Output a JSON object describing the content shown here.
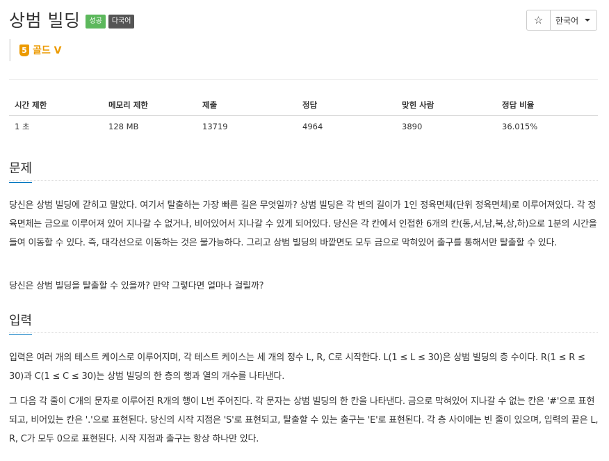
{
  "header": {
    "title": "상범 빌딩",
    "badge_success": "성공",
    "badge_lang": "다국어",
    "star_glyph": "☆",
    "language": "한국어"
  },
  "tier": {
    "number": "5",
    "label": "골드 V",
    "color": "#ec9a00"
  },
  "info_table": {
    "headers": [
      "시간 제한",
      "메모리 제한",
      "제출",
      "정답",
      "맞힌 사람",
      "정답 비율"
    ],
    "values": [
      "1 초",
      "128 MB",
      "13719",
      "4964",
      "3890",
      "36.015%"
    ]
  },
  "sections": {
    "problem": {
      "title": "문제",
      "paragraphs": [
        "당신은 상범 빌딩에 갇히고 말았다. 여기서 탈출하는 가장 빠른 길은 무엇일까? 상범 빌딩은 각 변의 길이가 1인 정육면체(단위 정육면체)로 이루어져있다. 각 정육면체는 금으로 이루어져 있어 지나갈 수 없거나, 비어있어서 지나갈 수 있게 되어있다. 당신은 각 칸에서 인접한 6개의 칸(동,서,남,북,상,하)으로 1분의 시간을 들여 이동할 수 있다. 즉, 대각선으로 이동하는 것은 불가능하다. 그리고 상범 빌딩의 바깥면도 모두 금으로 막혀있어 출구를 통해서만 탈출할 수 있다.",
        "당신은 상범 빌딩을 탈출할 수 있을까? 만약 그렇다면 얼마나 걸릴까?"
      ]
    },
    "input": {
      "title": "입력",
      "paragraphs": [
        "입력은 여러 개의 테스트 케이스로 이루어지며, 각 테스트 케이스는 세 개의 정수 L, R, C로 시작한다. L(1 ≤ L ≤ 30)은 상범 빌딩의 층 수이다. R(1 ≤ R ≤ 30)과 C(1 ≤ C ≤ 30)는 상범 빌딩의 한 층의 행과 열의 개수를 나타낸다.",
        "그 다음 각 줄이 C개의 문자로 이루어진 R개의 행이 L번 주어진다. 각 문자는 상범 빌딩의 한 칸을 나타낸다. 금으로 막혀있어 지나갈 수 없는 칸은 '#'으로 표현되고, 비어있는 칸은 '.'으로 표현된다. 당신의 시작 지점은 'S'로 표현되고, 탈출할 수 있는 출구는 'E'로 표현된다. 각 층 사이에는 빈 줄이 있으며, 입력의 끝은 L, R, C가 모두 0으로 표현된다. 시작 지점과 출구는 항상 하나만 있다."
      ]
    }
  }
}
